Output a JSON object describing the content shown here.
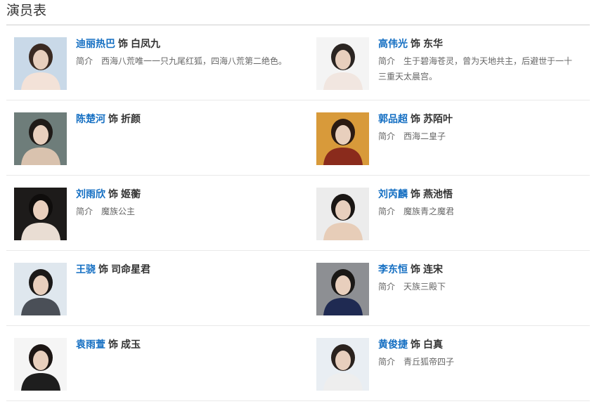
{
  "page_title": "演员表",
  "role_connector": "饰",
  "desc_label": "简介",
  "cast": [
    {
      "actor": "迪丽热巴",
      "role": "白凤九",
      "desc": "西海八荒唯一一只九尾红狐，四海八荒第二绝色。",
      "photo_bg": "#c9d9e8",
      "photo_fg": "#f3e2d8",
      "hair": "#3a2a22"
    },
    {
      "actor": "高伟光",
      "role": "东华",
      "desc": "生于碧海苍灵，曾为天地共主，后避世于一十三重天太晨宫。",
      "photo_bg": "#f4f4f4",
      "photo_fg": "#f1e6e0",
      "hair": "#2b2522"
    },
    {
      "actor": "陈楚河",
      "role": "折颜",
      "desc": "",
      "photo_bg": "#6e7d7a",
      "photo_fg": "#d9c2ae",
      "hair": "#1f1a17"
    },
    {
      "actor": "郭品超",
      "role": "苏陌叶",
      "desc": "西海二皇子",
      "photo_bg": "#d89a3a",
      "photo_fg": "#8a2b1c",
      "hair": "#2a1a12"
    },
    {
      "actor": "刘雨欣",
      "role": "姬蘅",
      "desc": "魔族公主",
      "photo_bg": "#1d1b1a",
      "photo_fg": "#e9ddd3",
      "hair": "#0f0d0c"
    },
    {
      "actor": "刘芮麟",
      "role": "燕池悟",
      "desc": "魔族青之魔君",
      "photo_bg": "#ececec",
      "photo_fg": "#e7cdb8",
      "hair": "#1a1614"
    },
    {
      "actor": "王骁",
      "role": "司命星君",
      "desc": "",
      "photo_bg": "#dfe7ee",
      "photo_fg": "#4a4f57",
      "hair": "#1b1918"
    },
    {
      "actor": "李东恒",
      "role": "连宋",
      "desc": "天族三殿下",
      "photo_bg": "#8d8f93",
      "photo_fg": "#1f2a52",
      "hair": "#1a1816"
    },
    {
      "actor": "袁雨萱",
      "role": "成玉",
      "desc": "",
      "photo_bg": "#f5f5f5",
      "photo_fg": "#1e1e1e",
      "hair": "#1c1614"
    },
    {
      "actor": "黄俊捷",
      "role": "白真",
      "desc": "青丘狐帝四子",
      "photo_bg": "#e9eef3",
      "photo_fg": "#eeeeee",
      "hair": "#2a221e"
    }
  ]
}
